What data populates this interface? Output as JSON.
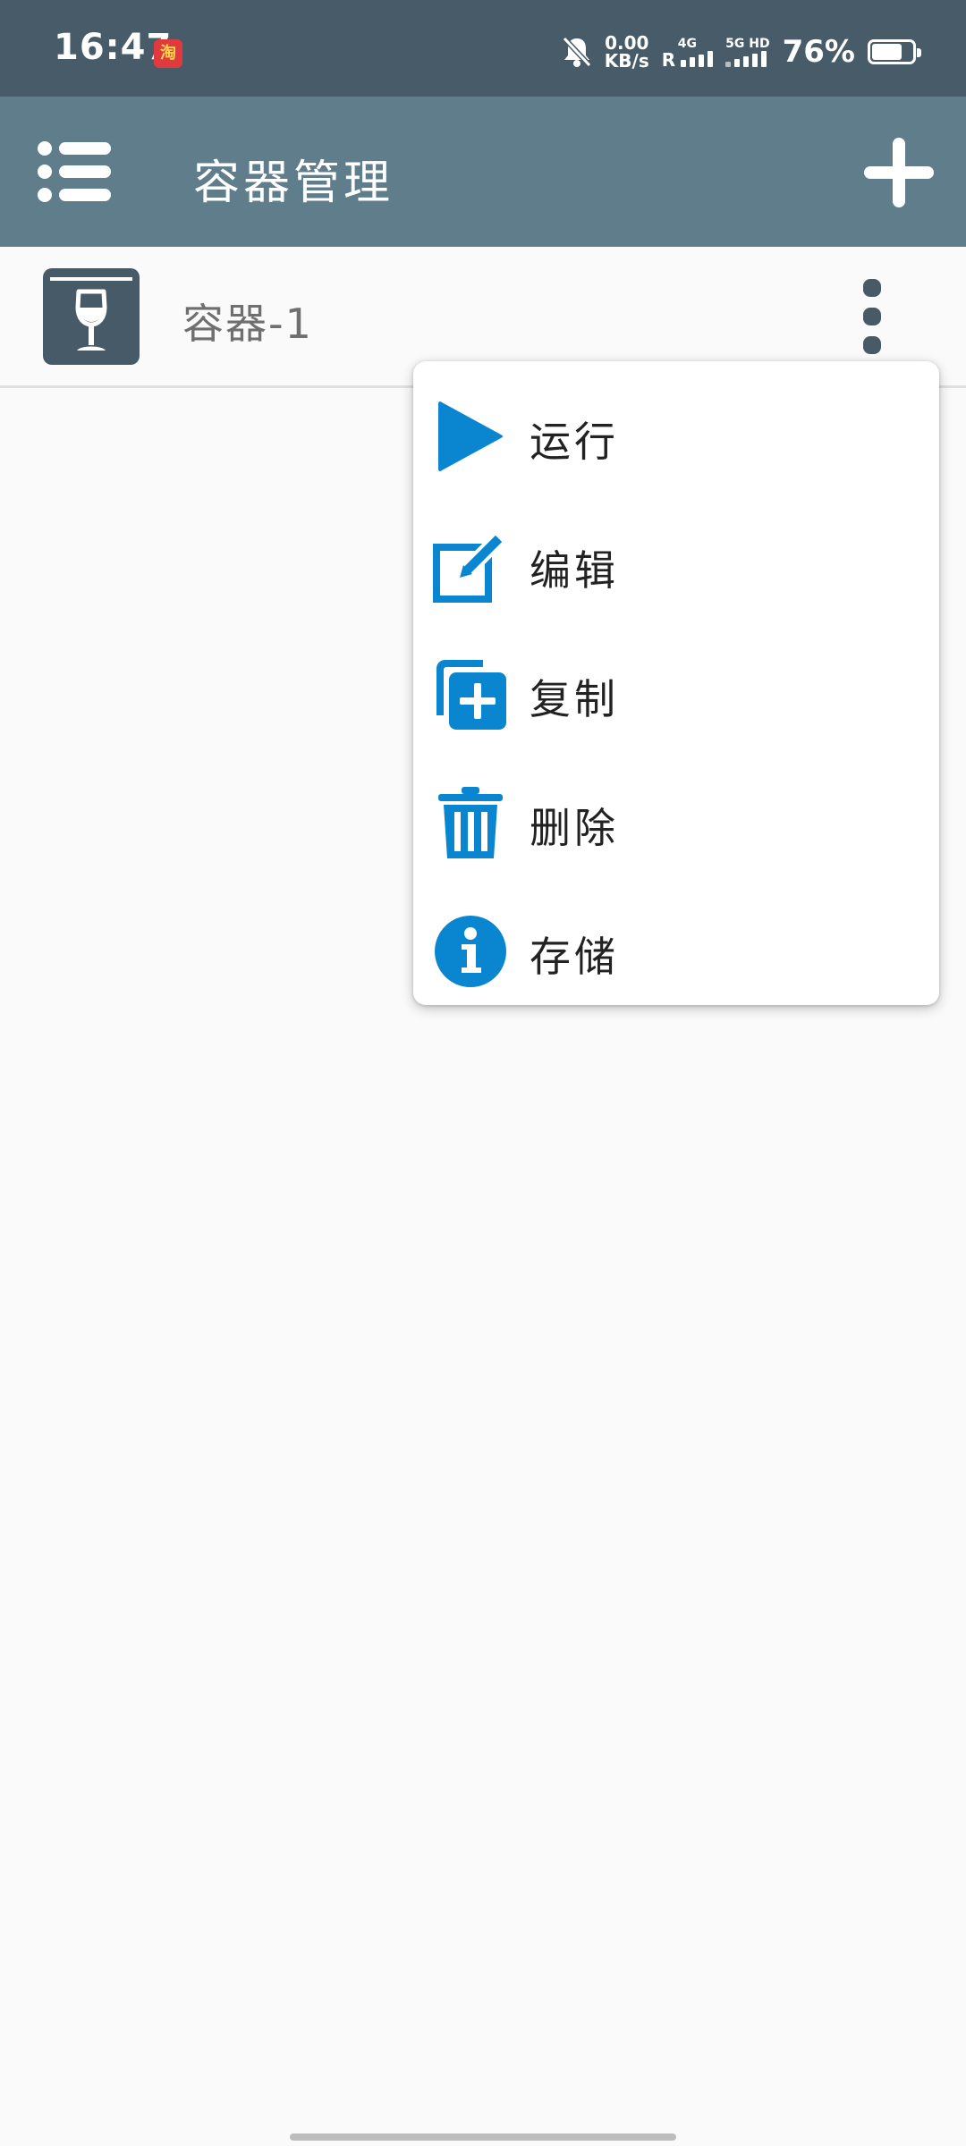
{
  "status_bar": {
    "time": "16:47",
    "app_icon_glyph": "淘",
    "net_speed_value": "0.00",
    "net_speed_unit": "KB/s",
    "sim1_label": "4G",
    "sim1_roaming": "R",
    "sim2_label": "5G HD",
    "battery_text": "76%",
    "battery_level": 0.76,
    "icons": [
      "taobao-app-icon",
      "bell-muted-icon",
      "signal-icon",
      "battery-icon"
    ]
  },
  "app_bar": {
    "title": "容器管理",
    "color": "#607d8b",
    "icons": [
      "menu-list-icon",
      "add-icon"
    ]
  },
  "containers": [
    {
      "label": "容器-1",
      "icon": "wine-glass-icon"
    }
  ],
  "context_menu": {
    "accent_color": "#0a86d0",
    "items": [
      {
        "label": "运行",
        "icon": "play-icon"
      },
      {
        "label": "编辑",
        "icon": "edit-icon"
      },
      {
        "label": "复制",
        "icon": "duplicate-icon"
      },
      {
        "label": "删除",
        "icon": "trash-icon"
      },
      {
        "label": "存储",
        "icon": "info-icon"
      }
    ]
  }
}
